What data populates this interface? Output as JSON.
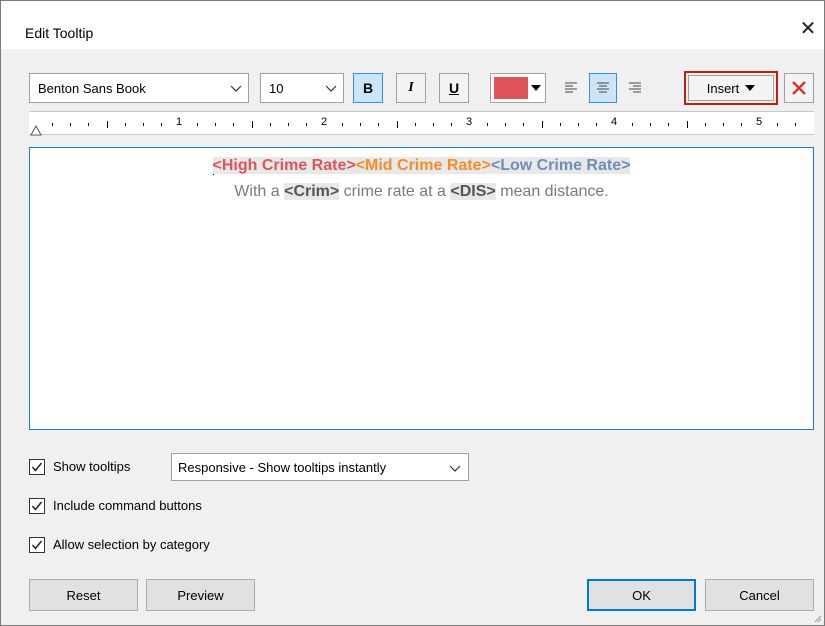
{
  "window": {
    "title": "Edit Tooltip",
    "close_icon": "close-icon"
  },
  "toolbar": {
    "font_family": "Benton Sans Book",
    "font_size": "10",
    "bold_label": "B",
    "italic_label": "I",
    "underline_label": "U",
    "text_color": "#e0535a",
    "insert_label": "Insert",
    "align_active": "center"
  },
  "ruler": {
    "numbers": [
      "1",
      "2",
      "3",
      "4",
      "5"
    ]
  },
  "editor": {
    "line1": {
      "high": "<High Crime Rate>",
      "mid": "<Mid Crime Rate>",
      "low": "<Low Crime Rate>"
    },
    "line2": {
      "pre": "With a ",
      "field1": "<Crim>",
      "mid": " crime rate at a ",
      "field2": "<DIS>",
      "post": " mean distance."
    },
    "colors": {
      "high": "#e0535a",
      "mid": "#f28e2b",
      "low": "#6d8fb6",
      "body": "#7a7a7a"
    }
  },
  "options": {
    "show_tooltips": {
      "label": "Show tooltips",
      "checked": true
    },
    "tooltip_mode": "Responsive - Show tooltips instantly",
    "include_command_buttons": {
      "label": "Include command buttons",
      "checked": true
    },
    "allow_selection_by_category": {
      "label": "Allow selection by category",
      "checked": true
    }
  },
  "buttons": {
    "reset": "Reset",
    "preview": "Preview",
    "ok": "OK",
    "cancel": "Cancel"
  }
}
